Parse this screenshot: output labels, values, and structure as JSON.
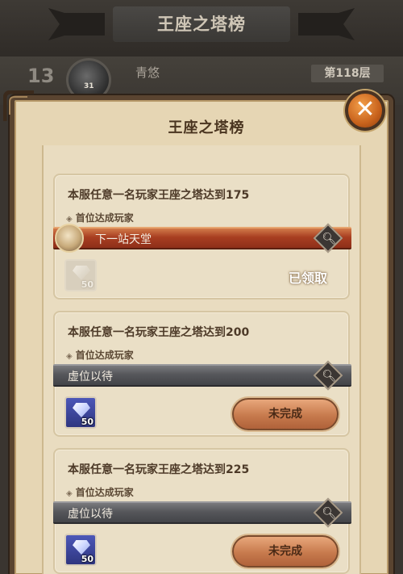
{
  "background": {
    "title": "王座之塔榜",
    "rank": "13",
    "avatar_level": "31",
    "player_name": "青悠",
    "floor": "第118层"
  },
  "dialog": {
    "title": "王座之塔榜",
    "close_icon": "close-icon"
  },
  "cards": [
    {
      "title": "本服任意一名玩家王座之塔达到175",
      "subtitle": "首位达成玩家",
      "player": "下一站天堂",
      "reward_qty": "50",
      "status": "已领取"
    },
    {
      "title": "本服任意一名玩家王座之塔达到200",
      "subtitle": "首位达成玩家",
      "player": "虚位以待",
      "reward_qty": "50",
      "status": "未完成"
    },
    {
      "title": "本服任意一名玩家王座之塔达到225",
      "subtitle": "首位达成玩家",
      "player": "虚位以待",
      "reward_qty": "50",
      "status": "未完成"
    }
  ],
  "colors": {
    "claimed_bar": "#a83e21",
    "empty_bar": "#56575b",
    "button": "#c77a4d"
  }
}
